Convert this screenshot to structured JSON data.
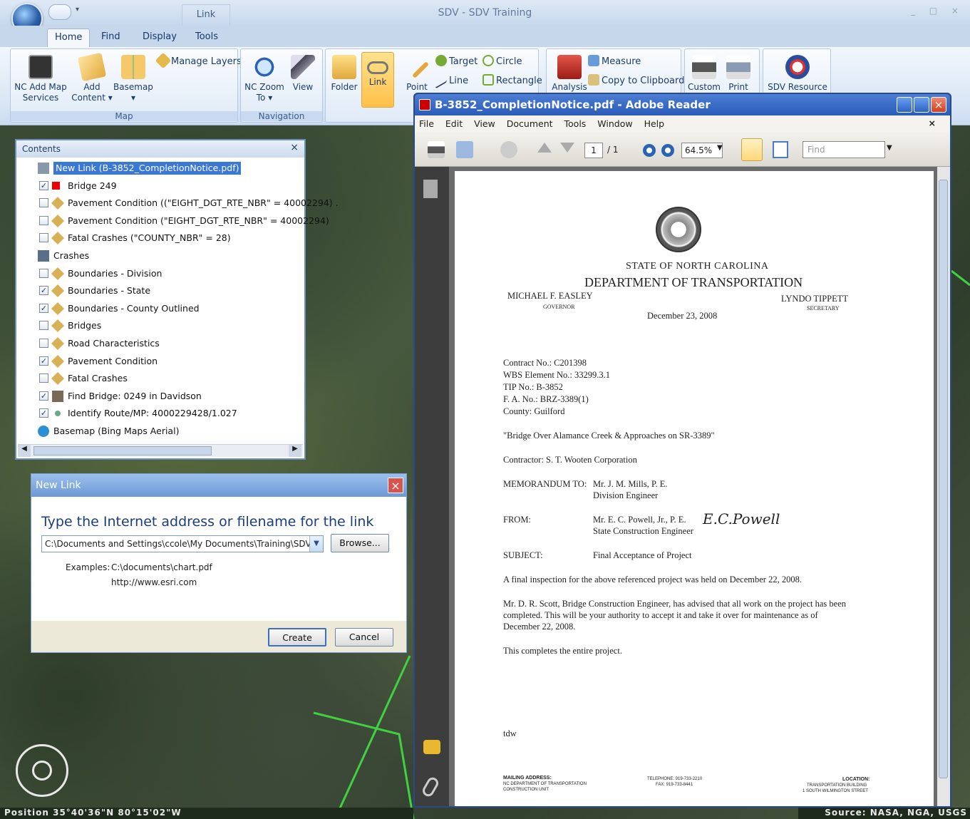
{
  "app": {
    "title": "SDV - SDV Training",
    "context_tab": "Link",
    "window_controls": "_ □ ×"
  },
  "tabs": [
    {
      "label": "Home",
      "active": true
    },
    {
      "label": "Find"
    },
    {
      "label": "Display"
    },
    {
      "label": "Tools"
    }
  ],
  "ribbon": {
    "map_group": {
      "label": "Map",
      "nc_add_map": "NC Add Map Services",
      "add_content": "Add Content ▾",
      "basemap": "Basemap ▾",
      "manage_layers": "Manage Layers"
    },
    "navigation_group": {
      "label": "Navigation",
      "nc_zoom_to": "NC Zoom To ▾",
      "view": "View"
    },
    "folder": "Folder",
    "link": "Link",
    "point": "Point",
    "target": "Target",
    "circle": "Circle",
    "line": "Line",
    "rectangle": "Rectangle",
    "analysis": "Analysis",
    "measure": "Measure",
    "copy_to_clipboard": "Copy to Clipboard",
    "custom": "Custom",
    "print": "Print",
    "sdv_resource": "SDV Resource"
  },
  "contents": {
    "title": "Contents",
    "close": "×",
    "layers": [
      {
        "label": "New Link (B-3852_CompletionNotice.pdf)",
        "checkbox": null,
        "icon": "link-icon",
        "selected": true
      },
      {
        "label": "Bridge 249",
        "checkbox": true,
        "icon": "red-square-icon"
      },
      {
        "label": "Pavement Condition ((\"EIGHT_DGT_RTE_NBR\" = 40002294) .",
        "checkbox": false,
        "icon": "layer-icon"
      },
      {
        "label": "Pavement Condition (\"EIGHT_DGT_RTE_NBR\" = 40002294)",
        "checkbox": false,
        "icon": "layer-icon"
      },
      {
        "label": "Fatal Crashes (\"COUNTY_NBR\" = 28)",
        "checkbox": false,
        "icon": "layer-icon"
      },
      {
        "label": "Crashes",
        "checkbox": null,
        "icon": "flashlight-icon"
      },
      {
        "label": "Boundaries - Division",
        "checkbox": false,
        "icon": "layer-icon"
      },
      {
        "label": "Boundaries - State",
        "checkbox": true,
        "icon": "layer-icon"
      },
      {
        "label": "Boundaries - County Outlined",
        "checkbox": true,
        "icon": "layer-icon"
      },
      {
        "label": "Bridges",
        "checkbox": false,
        "icon": "layer-icon"
      },
      {
        "label": "Road Characteristics",
        "checkbox": false,
        "icon": "layer-icon"
      },
      {
        "label": "Pavement Condition",
        "checkbox": true,
        "icon": "layer-icon"
      },
      {
        "label": "Fatal Crashes",
        "checkbox": false,
        "icon": "layer-icon"
      },
      {
        "label": "Find Bridge: 0249 in Davidson",
        "checkbox": true,
        "icon": "bridge-icon"
      },
      {
        "label": "Identify Route/MP: 4000229428/1.027",
        "checkbox": true,
        "icon": "dot-icon"
      },
      {
        "label": "Basemap (Bing Maps Aerial)",
        "checkbox": null,
        "icon": "globe-icon"
      }
    ]
  },
  "new_link": {
    "title": "New Link",
    "prompt": "Type the Internet address or filename for the link",
    "value": "C:\\Documents and Settings\\ccole\\My Documents\\Training\\SDV\\E",
    "browse": "Browse...",
    "examples_label": "Examples:",
    "example1": "C:\\documents\\chart.pdf",
    "example2": "http://www.esri.com",
    "create": "Create",
    "cancel": "Cancel"
  },
  "reader": {
    "title": "B-3852_CompletionNotice.pdf - Adobe Reader",
    "menu": [
      "File",
      "Edit",
      "View",
      "Document",
      "Tools",
      "Window",
      "Help"
    ],
    "menu_close": "×",
    "page": "1",
    "page_total": "/ 1",
    "zoom": "64.5%",
    "find_placeholder": "Find",
    "doc": {
      "state": "STATE OF NORTH CAROLINA",
      "dept": "DEPARTMENT OF TRANSPORTATION",
      "governor": "MICHAEL F. EASLEY",
      "governor_title": "GOVERNOR",
      "secretary": "LYNDO TIPPETT",
      "secretary_title": "SECRETARY",
      "date": "December 23, 2008",
      "contract": "Contract No.:  C201398",
      "wbs": "WBS Element No.:  33299.3.1",
      "tip": "TIP No.:  B-3852",
      "fa": "F. A. No.:  BRZ-3389(1)",
      "county": "County:  Guilford",
      "project": "\"Bridge Over Alamance Creek & Approaches on SR-3389\"",
      "contractor": "Contractor: S. T. Wooten Corporation",
      "memo_label": "MEMORANDUM TO:",
      "memo_to": "Mr. J. M. Mills, P. E.",
      "memo_title": "Division Engineer",
      "from_label": "FROM:",
      "from_name": "Mr. E. C. Powell, Jr., P. E.",
      "from_title": "State Construction Engineer",
      "signature": "E.C.Powell",
      "subject_label": "SUBJECT:",
      "subject": "Final Acceptance of Project",
      "p1": "A final inspection for the above referenced project was held on December 22, 2008.",
      "p2a": "Mr. D. R. Scott, Bridge Construction Engineer, has advised that all work on the project has been",
      "p2b": "completed.  This will be your authority to accept it and take it over for maintenance as of",
      "p2c": "December 22, 2008.",
      "p3": "This completes the entire project.",
      "initials": "tdw",
      "mail_label": "MAILING ADDRESS:",
      "mail1": "NC DEPARTMENT OF TRANSPORTATION",
      "mail2": "CONSTRUCTION UNIT",
      "phone": "TELEPHONE:  919-733-2210",
      "fax": "FAX:  919-733-8441",
      "loc_label": "LOCATION:",
      "loc1": "TRANSPORTATION BUILDING",
      "loc2": "1 SOUTH WILMINGTON STREET"
    }
  },
  "status": {
    "position": "Position 35°40'36\"N  80°15'02\"W",
    "source": "Source: NASA, NGA, USGS"
  }
}
